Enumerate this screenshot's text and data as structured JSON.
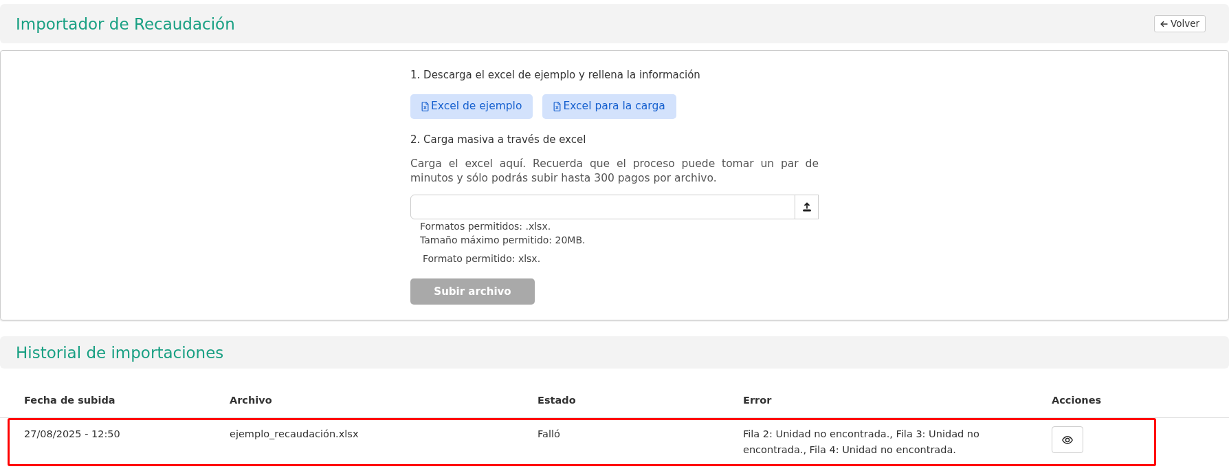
{
  "header": {
    "title": "Importador de Recaudación",
    "back_button": "Volver"
  },
  "upload_card": {
    "step_1": "1. Descarga el excel de ejemplo y rellena la información",
    "download_buttons": [
      "Excel de ejemplo",
      "Excel para la carga"
    ],
    "step_2": "2. Carga masiva a través de excel",
    "instructions": "Carga el excel aquí. Recuerda que el proceso puede tomar un par de minutos y sólo podrás subir hasta 300 pagos por archivo.",
    "file_help": [
      "Formatos permitidos: .xlsx.",
      "Tamaño máximo permitido: 20MB."
    ],
    "format_note": "Formato permitido: xlsx.",
    "submit_button": {
      "label": "Subir archivo",
      "disabled": true
    }
  },
  "history": {
    "title": "Historial de importaciones",
    "columns": [
      "Fecha de subida",
      "Archivo",
      "Estado",
      "Error",
      "Acciones"
    ],
    "rows": [
      {
        "uploaded_at": "27/08/2025 - 12:50",
        "file": "ejemplo_recaudación.xlsx",
        "status": "Falló",
        "error": "Fila 2: Unidad no encontrada., Fila 3: Unidad no encontrada., Fila 4: Unidad no encontrada.",
        "highlighted": true
      }
    ]
  }
}
